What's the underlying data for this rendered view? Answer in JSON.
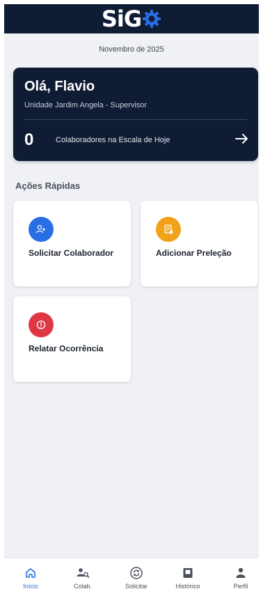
{
  "app": {
    "logo_text": "SiG"
  },
  "header": {
    "date": "Novembro de 2025"
  },
  "hero": {
    "greeting": "Olá, Flavio",
    "unit": "Unidade Jardim Angela - Supervisor",
    "count": "0",
    "count_label": "Colaboradores na Escala de Hoje",
    "arrow_icon": "arrow-right-icon"
  },
  "quick_actions": {
    "title": "Ações Rápidas",
    "items": [
      {
        "label": "Solicitar Colaborador",
        "icon": "user-add-icon",
        "color": "#2a6ee6"
      },
      {
        "label": "Adicionar Preleção",
        "icon": "document-add-icon",
        "color": "#f1a21a"
      },
      {
        "label": "Relatar Ocorrência",
        "icon": "alert-icon",
        "color": "#df3646"
      }
    ]
  },
  "nav": {
    "items": [
      {
        "label": "Início",
        "icon": "home-icon",
        "active": true
      },
      {
        "label": "Colab.",
        "icon": "users-search-icon",
        "active": false
      },
      {
        "label": "Solicitar",
        "icon": "request-cycle-icon",
        "active": false
      },
      {
        "label": "Histórico",
        "icon": "history-book-icon",
        "active": false
      },
      {
        "label": "Perfil",
        "icon": "person-icon",
        "active": false
      }
    ]
  },
  "colors": {
    "brand_dark": "#0f1c33",
    "accent_blue": "#2a6ee6",
    "accent_orange": "#f1a21a",
    "accent_red": "#df3646",
    "background": "#eff1f5"
  }
}
